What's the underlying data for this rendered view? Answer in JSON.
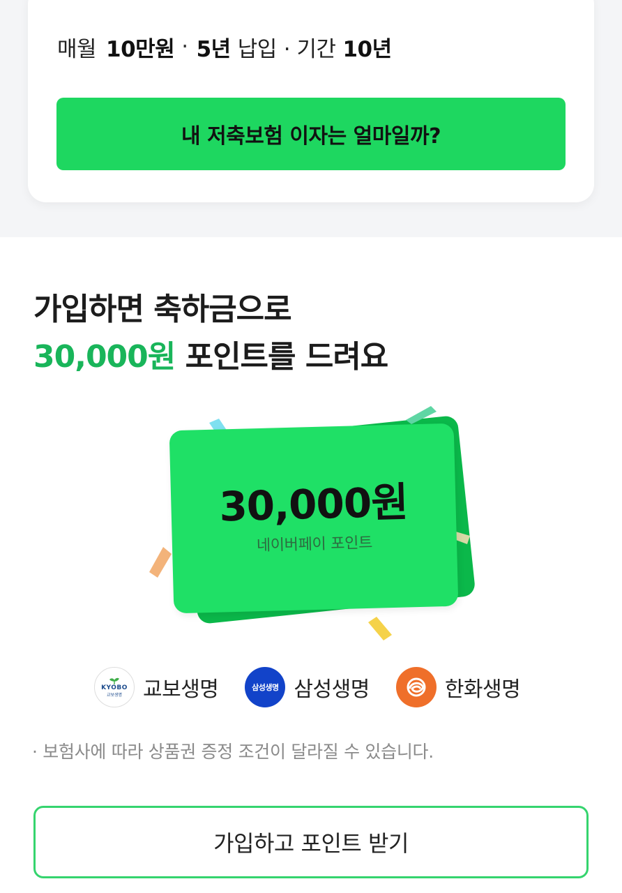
{
  "plan": {
    "monthly_label": "매월",
    "monthly_amount": "10만원",
    "separator": "·",
    "pay_years": "5년",
    "pay_label": "납입",
    "term_label": "· 기간",
    "term_years": "10년"
  },
  "calc_button": {
    "label": "내 저축보험 이자는 얼마일까?"
  },
  "headline": {
    "line1": "가입하면 축하금으로",
    "amount": "30,000원",
    "line2_rest": " 포인트를 드려요"
  },
  "reward_card": {
    "amount": "30,000원",
    "caption": "네이버페이 포인트"
  },
  "insurers": [
    {
      "name": "교보생명",
      "logo_text": "KYOBO",
      "logo_sub": "교보생명",
      "icon": "kyobo-logo"
    },
    {
      "name": "삼성생명",
      "logo_text": "삼성생명",
      "icon": "samsung-logo"
    },
    {
      "name": "한화생명",
      "icon": "hanwha-logo"
    }
  ],
  "notice": "· 보험사에 따라 상품권 증정 조건이 달라질 수 있습니다.",
  "join_button": {
    "label": "가입하고 포인트 받기"
  },
  "colors": {
    "accent_green": "#1ed760",
    "headline_green": "#19b55a",
    "samsung_blue": "#1243c9",
    "hanwha_orange": "#ef6f2a"
  }
}
